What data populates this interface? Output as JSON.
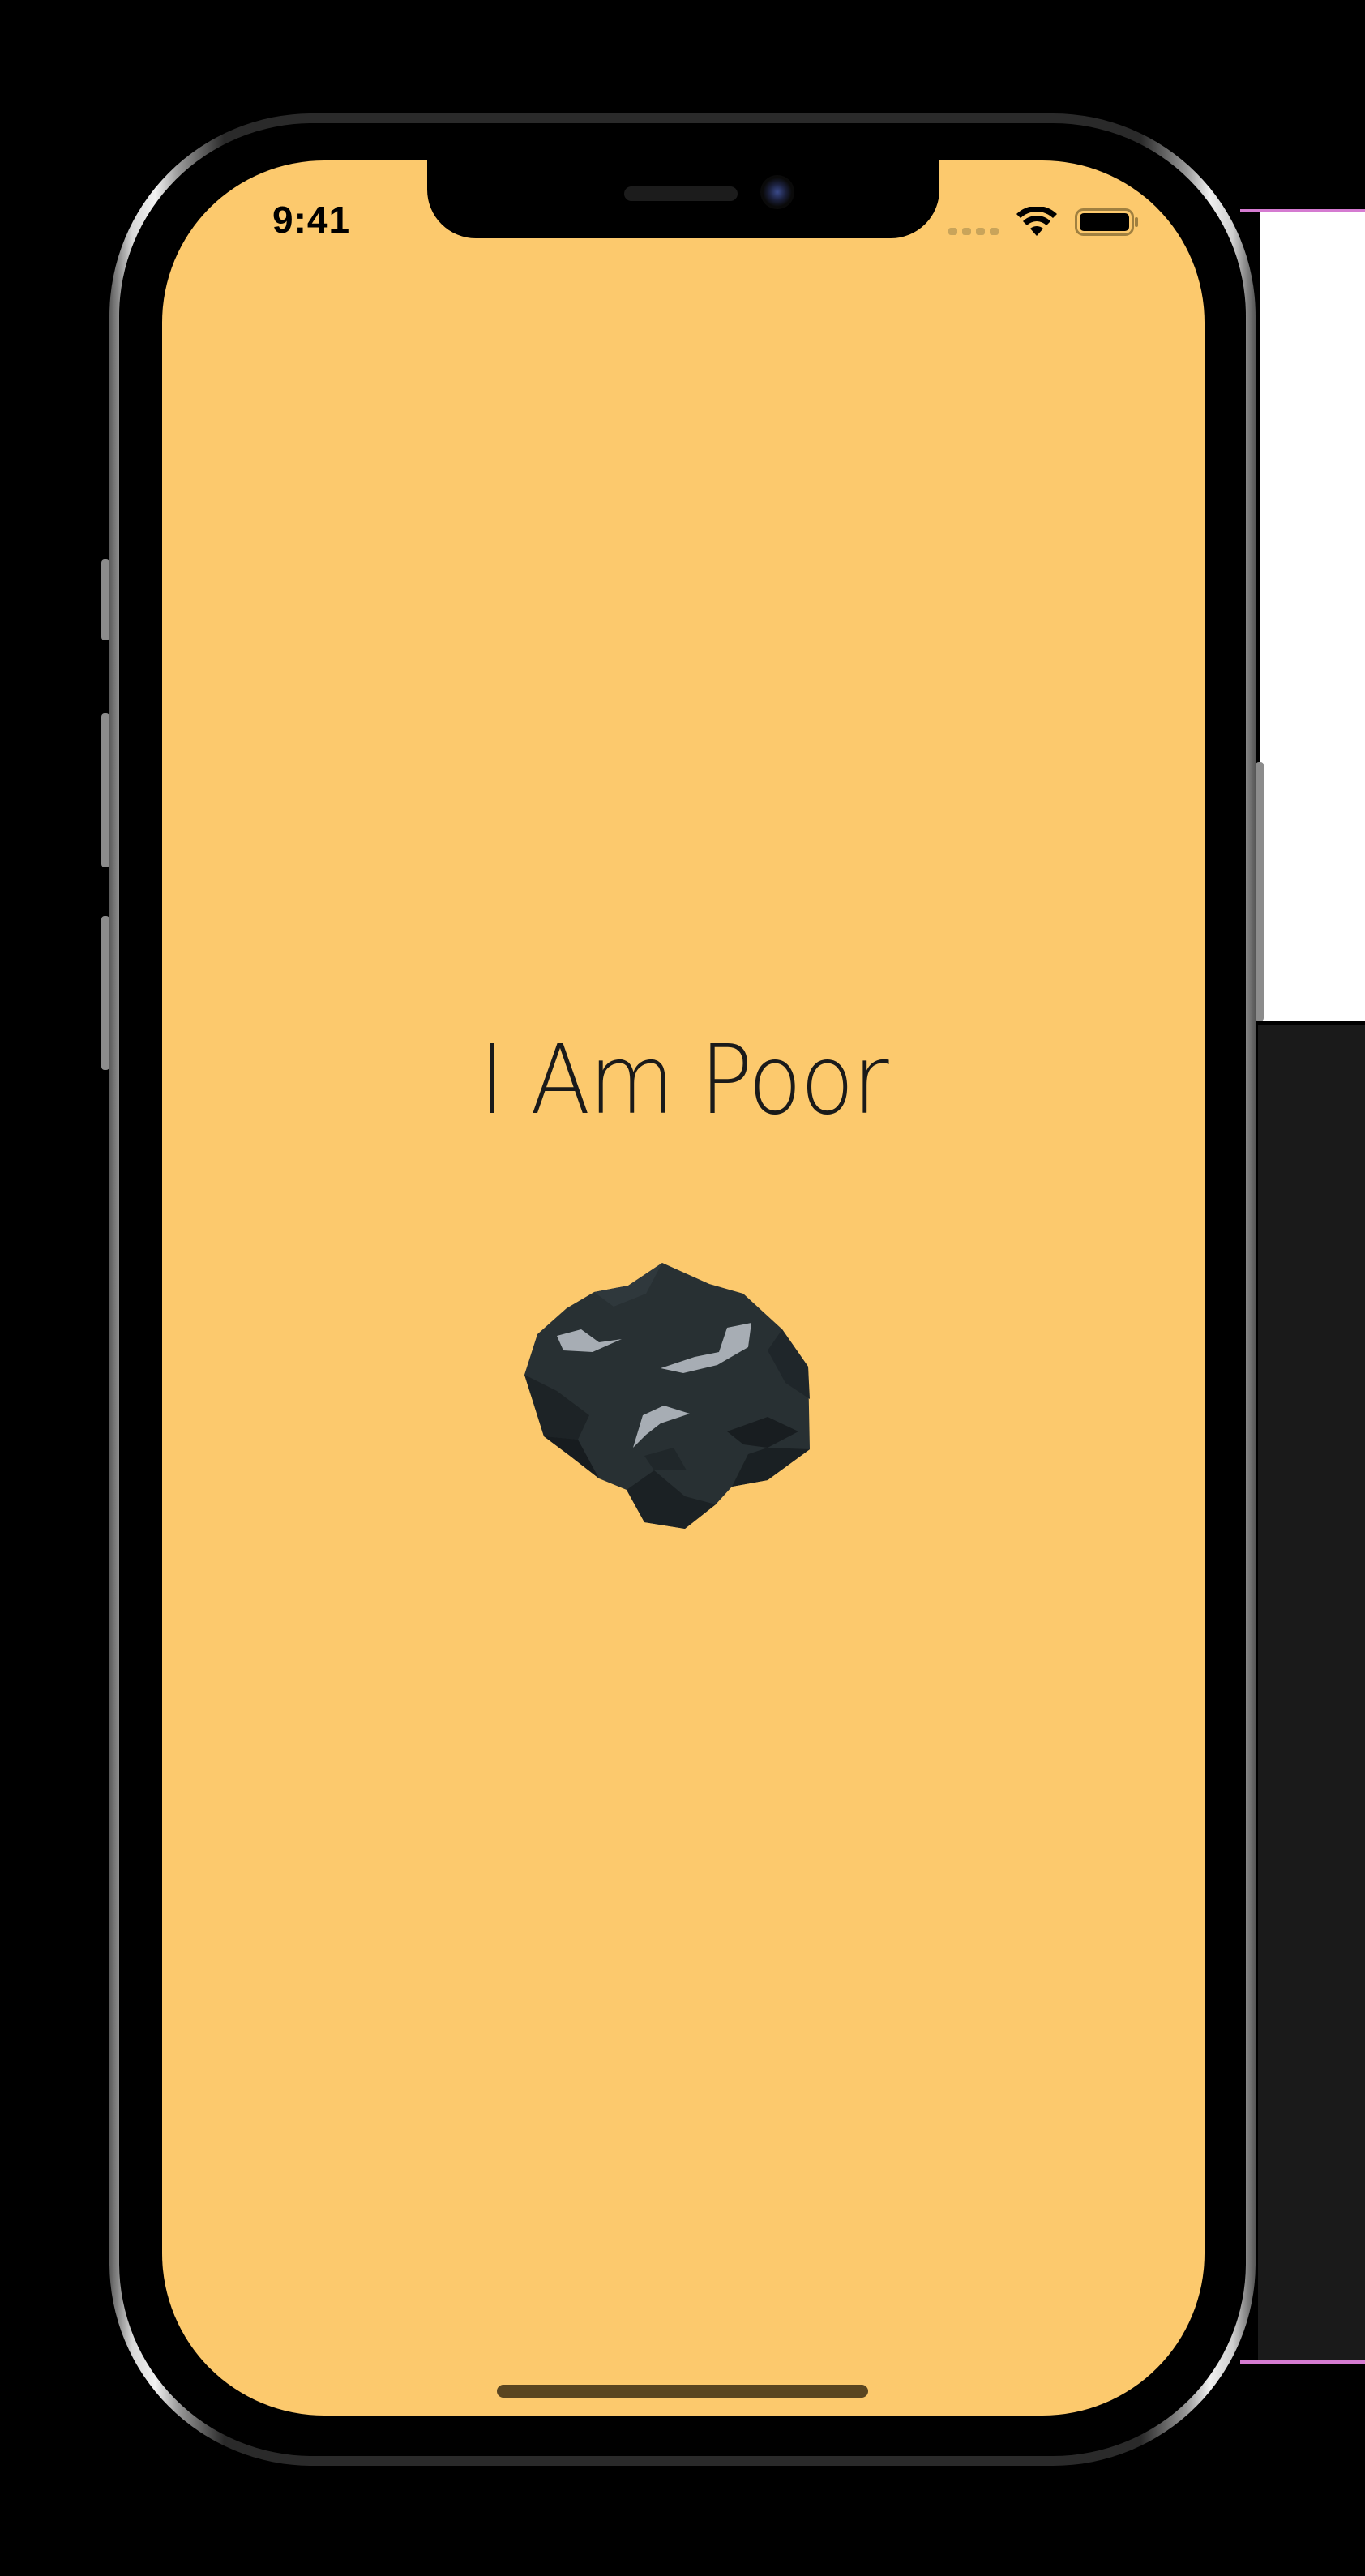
{
  "status_bar": {
    "time": "9:41",
    "wifi_icon": "wifi-icon",
    "battery_icon": "battery-icon",
    "signal_icon": "signal-dots-icon"
  },
  "main": {
    "title": "I Am Poor",
    "image_icon": "coal-rock-icon",
    "background_color": "#fcc96d"
  }
}
